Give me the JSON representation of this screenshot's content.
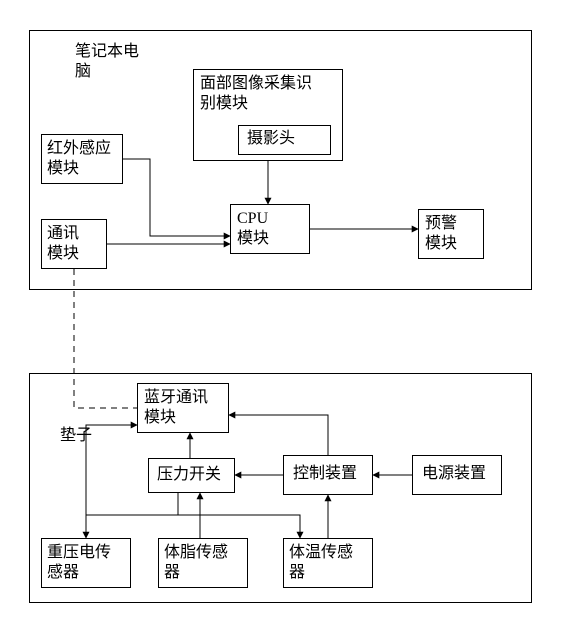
{
  "top_group": {
    "title": "笔记本电\n脑",
    "nodes": {
      "infrared": "红外感应\n模块",
      "comm": "通讯\n模块",
      "face_recog": "面部图像采集识\n别模块",
      "camera": "摄影头",
      "cpu": "CPU\n模块",
      "alarm": "预警\n模块"
    }
  },
  "bottom_group": {
    "title": "垫子",
    "nodes": {
      "bluetooth": "蓝牙通讯\n模块",
      "press_sw": "压力开关",
      "controller": "控制装置",
      "power": "电源装置",
      "piezo": "重压电传\n感器",
      "fat": "体脂传感\n器",
      "temp": "体温传感\n器"
    }
  }
}
